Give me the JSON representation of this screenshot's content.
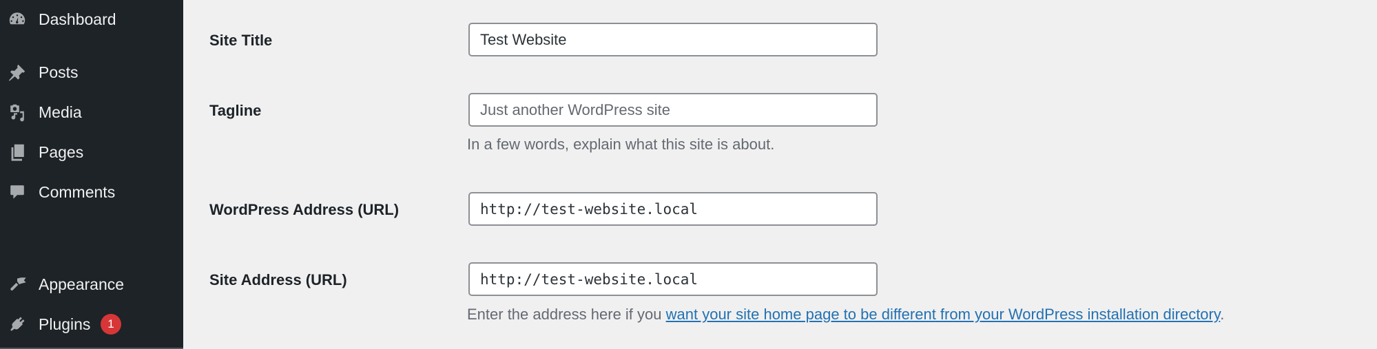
{
  "sidebar": {
    "items": [
      {
        "label": "Dashboard",
        "icon": "dashboard-icon"
      },
      {
        "label": "Posts",
        "icon": "pushpin-icon"
      },
      {
        "label": "Media",
        "icon": "media-icon"
      },
      {
        "label": "Pages",
        "icon": "pages-icon"
      },
      {
        "label": "Comments",
        "icon": "comment-icon"
      },
      {
        "label": "Appearance",
        "icon": "paintbrush-icon"
      },
      {
        "label": "Plugins",
        "icon": "plugin-icon",
        "badge": "1"
      }
    ]
  },
  "settings": {
    "site_title": {
      "label": "Site Title",
      "value": "Test Website"
    },
    "tagline": {
      "label": "Tagline",
      "value": "",
      "placeholder": "Just another WordPress site",
      "description": "In a few words, explain what this site is about."
    },
    "wordpress_address": {
      "label": "WordPress Address (URL)",
      "value": "http://test-website.local"
    },
    "site_address": {
      "label": "Site Address (URL)",
      "value": "http://test-website.local",
      "description_prefix": "Enter the address here if you ",
      "description_link": "want your site home page to be different from your WordPress installation directory",
      "description_suffix": "."
    }
  },
  "colors": {
    "sidebar_bg": "#1d2327",
    "page_bg": "#f0f0f1",
    "link": "#2271b1",
    "badge": "#d63638"
  }
}
